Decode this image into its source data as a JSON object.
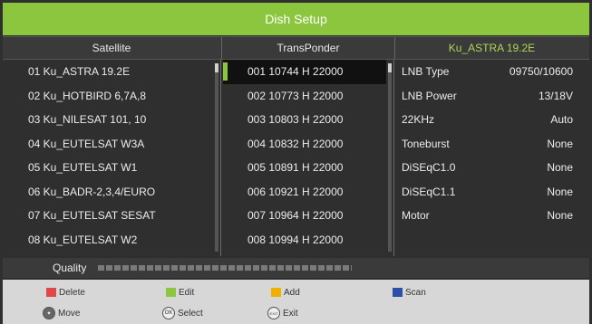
{
  "title": "Dish Setup",
  "columns": {
    "satellite": "Satellite",
    "transponder": "TransPonder",
    "selected_satellite": "Ku_ASTRA 19.2E"
  },
  "satellites": [
    "01 Ku_ASTRA 19.2E",
    "02 Ku_HOTBIRD 6,7A,8",
    "03 Ku_NILESAT 101, 10",
    "04 Ku_EUTELSAT W3A",
    "05 Ku_EUTELSAT W1",
    "06 Ku_BADR-2,3,4/EURO",
    "07 Ku_EUTELSAT SESAT",
    "08 Ku_EUTELSAT W2"
  ],
  "transponders": [
    "001 10744 H 22000",
    "002 10773 H 22000",
    "003 10803 H 22000",
    "004 10832 H 22000",
    "005 10891 H 22000",
    "006 10921 H 22000",
    "007 10964 H 22000",
    "008 10994 H 22000"
  ],
  "selected_transponder_index": 0,
  "lnb_settings": [
    {
      "key": "LNB Type",
      "value": "09750/10600"
    },
    {
      "key": "LNB Power",
      "value": "13/18V"
    },
    {
      "key": "22KHz",
      "value": "Auto"
    },
    {
      "key": "Toneburst",
      "value": "None"
    },
    {
      "key": "DiSEqC1.0",
      "value": "None"
    },
    {
      "key": "DiSEqC1.1",
      "value": "None"
    },
    {
      "key": "Motor",
      "value": "None"
    }
  ],
  "quality_label": "Quality",
  "help": {
    "delete": "Delete",
    "edit": "Edit",
    "add": "Add",
    "scan": "Scan",
    "move": "Move",
    "select": "Select",
    "exit": "Exit",
    "ok_glyph": "OK",
    "exit_glyph": "EXIT"
  },
  "colors": {
    "accent": "#8cc63f",
    "delete": "#e04848",
    "edit": "#8cc63f",
    "add": "#f0b000",
    "scan": "#2c4fa8"
  }
}
